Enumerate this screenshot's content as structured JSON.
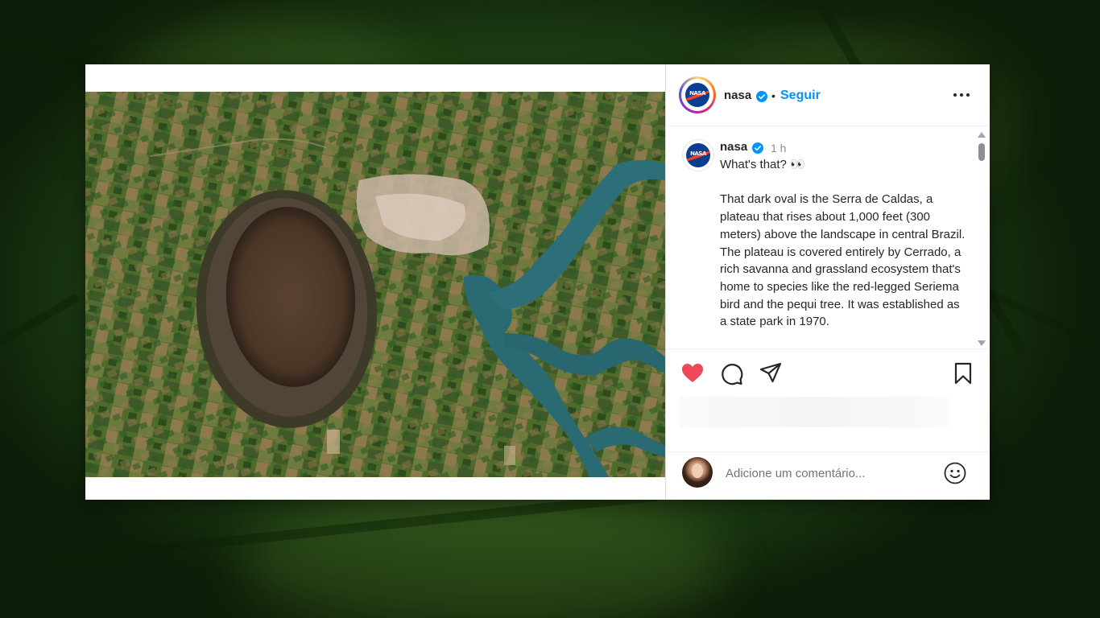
{
  "post": {
    "header": {
      "username": "nasa",
      "separator": "•",
      "follow_label": "Seguir"
    },
    "caption": {
      "username": "nasa",
      "time": "1 h",
      "text": "What's that? 👀\n\nThat dark oval is the Serra de Caldas, a plateau that rises about 1,000 feet (300 meters) above the landscape in central Brazil. The plateau is covered entirely by Cerrado, a rich savanna and grassland ecosystem that's home to species like the red-legged Seriema bird and the pequi tree. It was established as a state park in 1970."
    },
    "actions": {
      "liked": true,
      "icons": [
        "heart-icon",
        "comment-icon",
        "share-icon",
        "bookmark-icon"
      ]
    },
    "comment_box": {
      "placeholder": "Adicione um comentário..."
    },
    "logo_text": "NASA"
  },
  "colors": {
    "follow": "#0095f6",
    "like": "#ed4956",
    "verified": "#0095f6",
    "nasa_blue": "#0b3d91",
    "nasa_red": "#fc3d21"
  }
}
